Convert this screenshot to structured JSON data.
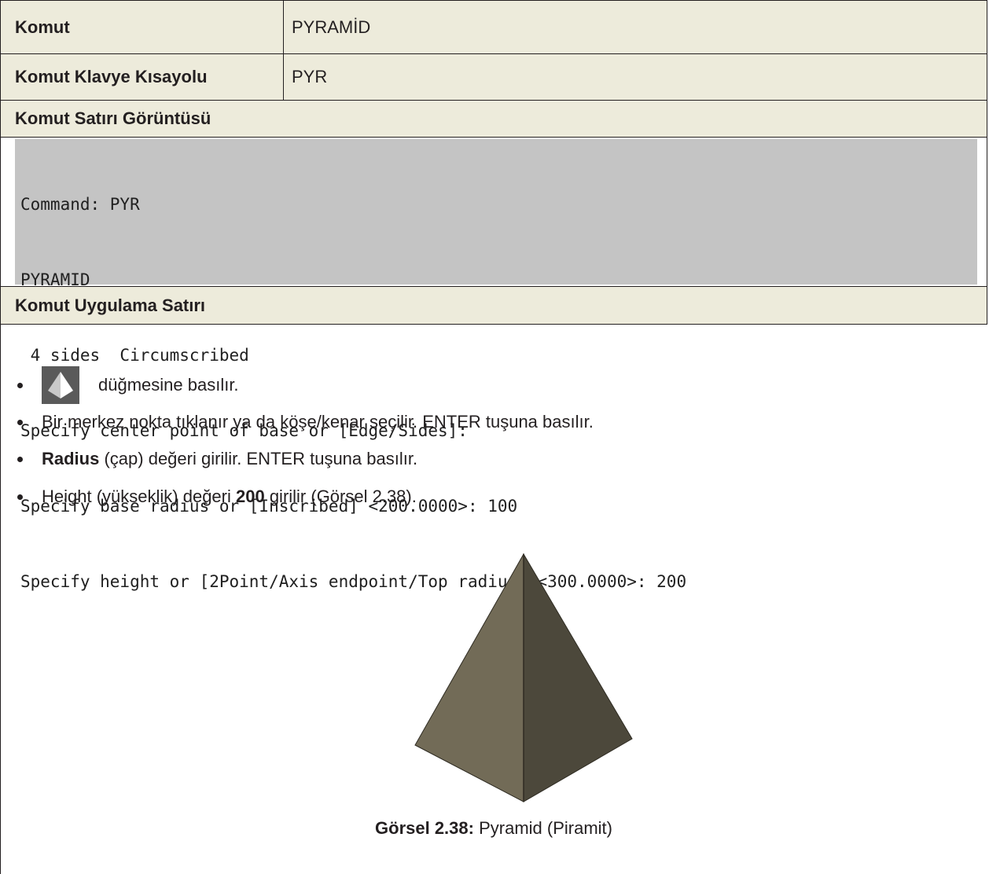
{
  "table": {
    "komut_label": "Komut",
    "komut_value": "PYRAMİD",
    "shortcut_label": "Komut Klavye Kısayolu",
    "shortcut_value": "PYR",
    "cmdline_header": "Komut Satırı Görüntüsü",
    "cmdline_lines": [
      "Command: PYR",
      "PYRAMID",
      " 4 sides  Circumscribed",
      "Specify center point of base or [Edge/Sides]:",
      "Specify base radius or [Inscribed] <200.0000>: 100",
      "Specify height or [2Point/Axis endpoint/Top radius] <300.0000>: 200"
    ],
    "apply_header": "Komut Uygulama Satırı"
  },
  "steps": {
    "s1_text": "düğmesine basılır.",
    "s1_icon": "pyramid-tool-icon",
    "s2_text": "Bir merkez nokta tıklanır ya da köşe/kenar  seçilir. ENTER tuşuna basılır.",
    "s3_bold": "Radius",
    "s3_text": " (çap) değeri girilir. ENTER tuşuna basılır.",
    "s4_pre": "Height (yükseklik) değeri ",
    "s4_bold": "200",
    "s4_post": " girilir (Görsel 2.38)."
  },
  "figure": {
    "caption_bold": "Görsel 2.38:",
    "caption_text": " Pyramid (Piramit)",
    "colors": {
      "left_face": "#726b57",
      "right_face": "#4c483b",
      "edge": "#2e2b22"
    }
  }
}
